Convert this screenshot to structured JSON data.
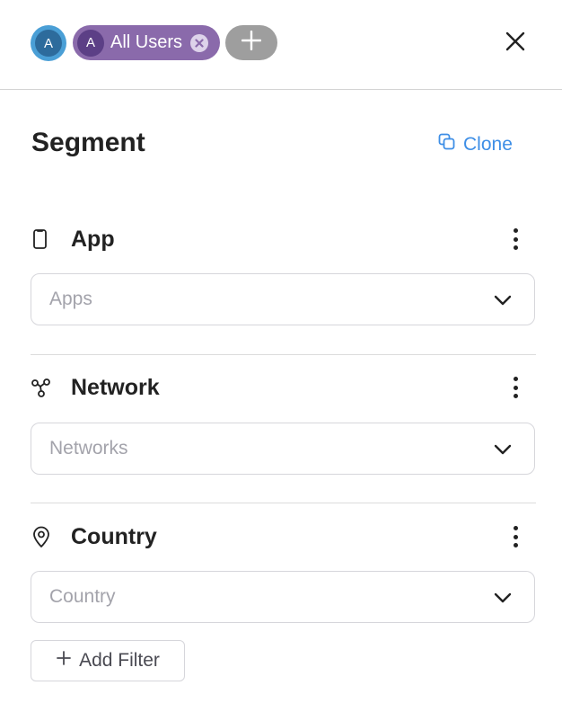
{
  "header": {
    "user_avatar_initial": "A",
    "segment_chip": {
      "avatar_initial": "A",
      "label": "All Users"
    },
    "icons": {
      "chip_remove": "close-circle-icon",
      "add_segment": "plus-icon",
      "close": "close-icon"
    }
  },
  "main": {
    "title": "Segment",
    "clone_label": "Clone",
    "clone_icon": "copy-icon",
    "sections": [
      {
        "title": "App",
        "icon": "mobile-phone-icon",
        "placeholder": "Apps"
      },
      {
        "title": "Network",
        "icon": "network-nodes-icon",
        "placeholder": "Networks"
      },
      {
        "title": "Country",
        "icon": "location-pin-icon",
        "placeholder": "Country"
      }
    ],
    "add_filter_label": "Add Filter"
  },
  "colors": {
    "accent_blue": "#3d8ee6",
    "chip_purple": "#8a6aab",
    "chip_avatar_purple": "#5c3f86",
    "user_avatar_blue": "#2d6b9c",
    "add_chip_gray": "#9e9e9e"
  }
}
